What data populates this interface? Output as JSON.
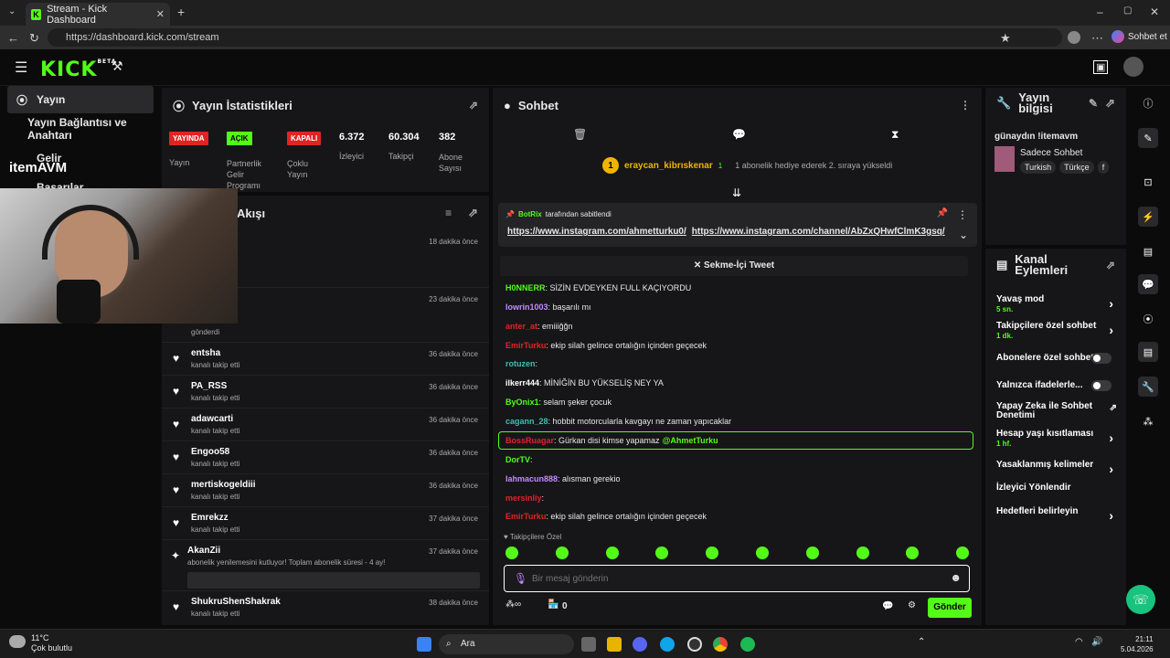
{
  "browser": {
    "tab_title": "Stream - Kick Dashboard",
    "url": "https://dashboard.kick.com/stream",
    "sidebar_label": "Sohbet et"
  },
  "header": {
    "logo": "KICK",
    "logo_sup": "BETA"
  },
  "leftnav": {
    "items": [
      {
        "label": "Yayın"
      },
      {
        "label": "Yayın Bağlantısı ve Anahtarı"
      },
      {
        "label": "Gelir"
      },
      {
        "label": "Başarılar"
      }
    ],
    "overlay_logo": "itemAVM"
  },
  "stats": {
    "title": "Yayın İstatistikleri",
    "items": [
      {
        "badge": "YAYINDA",
        "label": "Yayın",
        "badge_color": "#e02424"
      },
      {
        "badge": "AÇIK",
        "label": "Partnerlik Gelir Programı",
        "badge_color": "#53fc18"
      },
      {
        "badge": "KAPALI",
        "label": "Çoklu Yayın",
        "badge_color": "#e02424"
      },
      {
        "value": "6.372",
        "label": "İzleyici"
      },
      {
        "value": "60.304",
        "label": "Takipçi"
      },
      {
        "value": "382",
        "label": "Abone Sayısı"
      }
    ]
  },
  "activity": {
    "title": "Akışı",
    "items": [
      {
        "user": "",
        "sub": "",
        "time": "18 dakika önce"
      },
      {
        "user": "",
        "sub": "gönderdi",
        "time": "23 dakika önce"
      },
      {
        "user": "entsha",
        "sub": "kanalı takip etti",
        "time": "36 dakika önce"
      },
      {
        "user": "PA_RSS",
        "sub": "kanalı takip etti",
        "time": "36 dakika önce"
      },
      {
        "user": "adawcarti",
        "sub": "kanalı takip etti",
        "time": "36 dakika önce"
      },
      {
        "user": "Engoo58",
        "sub": "kanalı takip etti",
        "time": "36 dakika önce"
      },
      {
        "user": "mertiskogeldiii",
        "sub": "kanalı takip etti",
        "time": "36 dakika önce"
      },
      {
        "user": "Emrekzz",
        "sub": "kanalı takip etti",
        "time": "37 dakika önce"
      },
      {
        "user": "AkanZii",
        "sub": "abonelik yenilemesini kutluyor! Toplam abonelik süresi - 4 ay!",
        "time": "37 dakika önce"
      },
      {
        "user": "ShukruShenShakrak",
        "sub": "kanalı takip etti",
        "time": "38 dakika önce"
      }
    ]
  },
  "chat": {
    "title": "Sohbet",
    "gifter": "eraycan_kibrıskenar",
    "gifter_count": "1",
    "gift_text": "1 abonelik hediye ederek 2. sıraya yükseldi",
    "pinned_by": "BotRix",
    "pinned_suffix": "tarafından sabitlendi",
    "pinned_link1": "https://www.instagram.com/ahmetturku0/",
    "pinned_link2": "https://www.instagram.com/channel/AbZxQHwfClmK3gsq/",
    "tweet_btn": "Sekme-İçi Tweet",
    "messages": [
      {
        "user": "H0NNERR",
        "color": "#53fc18",
        "text": ": SİZİN EVDEYKEN FULL KAÇIYORDU"
      },
      {
        "user": "lowrin1003",
        "color": "#c38bff",
        "text": ": başarılı mı"
      },
      {
        "user": "anter_at",
        "color": "#e02424",
        "text": ": emiiiğğn"
      },
      {
        "user": "EmirTurku",
        "color": "#e02424",
        "text": ": ekip silah gelince ortalığın içinden geçecek"
      },
      {
        "user": "rotuzen",
        "color": "#38c2b0",
        "text": ":"
      },
      {
        "user": "ilkerr444",
        "color": "#ffffff",
        "text": ": MİNİĞİN BU YÜKSELİŞ NEY YA"
      },
      {
        "user": "ByOnix1",
        "color": "#53fc18",
        "text": ": selam şeker çocuk"
      },
      {
        "user": "cagann_28",
        "color": "#38c2b0",
        "text": ": hobbit motorcularla kavgayı ne zaman yapıcaklar"
      },
      {
        "user": "BossRuagar",
        "color": "#e02424",
        "text": ": Gürkan disi kimse yapamaz",
        "mention": "@AhmetTurku"
      },
      {
        "user": "DorTV",
        "color": "#53fc18",
        "text": ":"
      },
      {
        "user": "lahmacun888",
        "color": "#c38bff",
        "text": ": alısman gerekio"
      },
      {
        "user": "mersinliy",
        "color": "#e02424",
        "text": ":"
      },
      {
        "user": "EmirTurku",
        "color": "#e02424",
        "text": ": ekip silah gelince ortalığın içinden geçecek"
      }
    ],
    "followers_only": "Takipçilere Özel",
    "input_placeholder": "Bir mesaj gönderin",
    "send_btn": "Gönder",
    "points": "0"
  },
  "streaminfo": {
    "title": "Yayın bilgisi",
    "stream_title": "günaydın !itemavm",
    "category": "Sadece Sohbet",
    "tags": [
      "Turkish",
      "Türkçe",
      "f"
    ]
  },
  "channel": {
    "title": "Kanal Eylemleri",
    "rows": [
      {
        "label": "Yavaş mod",
        "sub": "5 sn.",
        "kind": "chev"
      },
      {
        "label": "Takipçilere özel sohbet",
        "sub": "1 dk.",
        "kind": "chev"
      },
      {
        "label": "Abonelere özel sohbet",
        "sub": "",
        "kind": "toggle"
      },
      {
        "label": "Yalnızca ifadelerle...",
        "sub": "",
        "kind": "toggle"
      },
      {
        "label": "Yapay Zeka ile Sohbet Denetimi",
        "sub": "",
        "kind": "ext"
      },
      {
        "label": "Hesap yaşı kısıtlaması",
        "sub": "1 hf.",
        "kind": "chev"
      },
      {
        "label": "Yasaklanmış kelimeler",
        "sub": "",
        "kind": "chev"
      },
      {
        "label": "İzleyici Yönlendir",
        "sub": "",
        "kind": "none"
      },
      {
        "label": "Hedefleri belirleyin",
        "sub": "",
        "kind": "chev"
      }
    ]
  },
  "taskbar": {
    "weather_temp": "11°C",
    "weather_desc": "Çok bulutlu",
    "search": "Ara",
    "time": "21:11",
    "date": "5.04.2026"
  },
  "colors": {
    "accent": "#53fc18",
    "danger": "#e02424",
    "panel": "#161618"
  }
}
